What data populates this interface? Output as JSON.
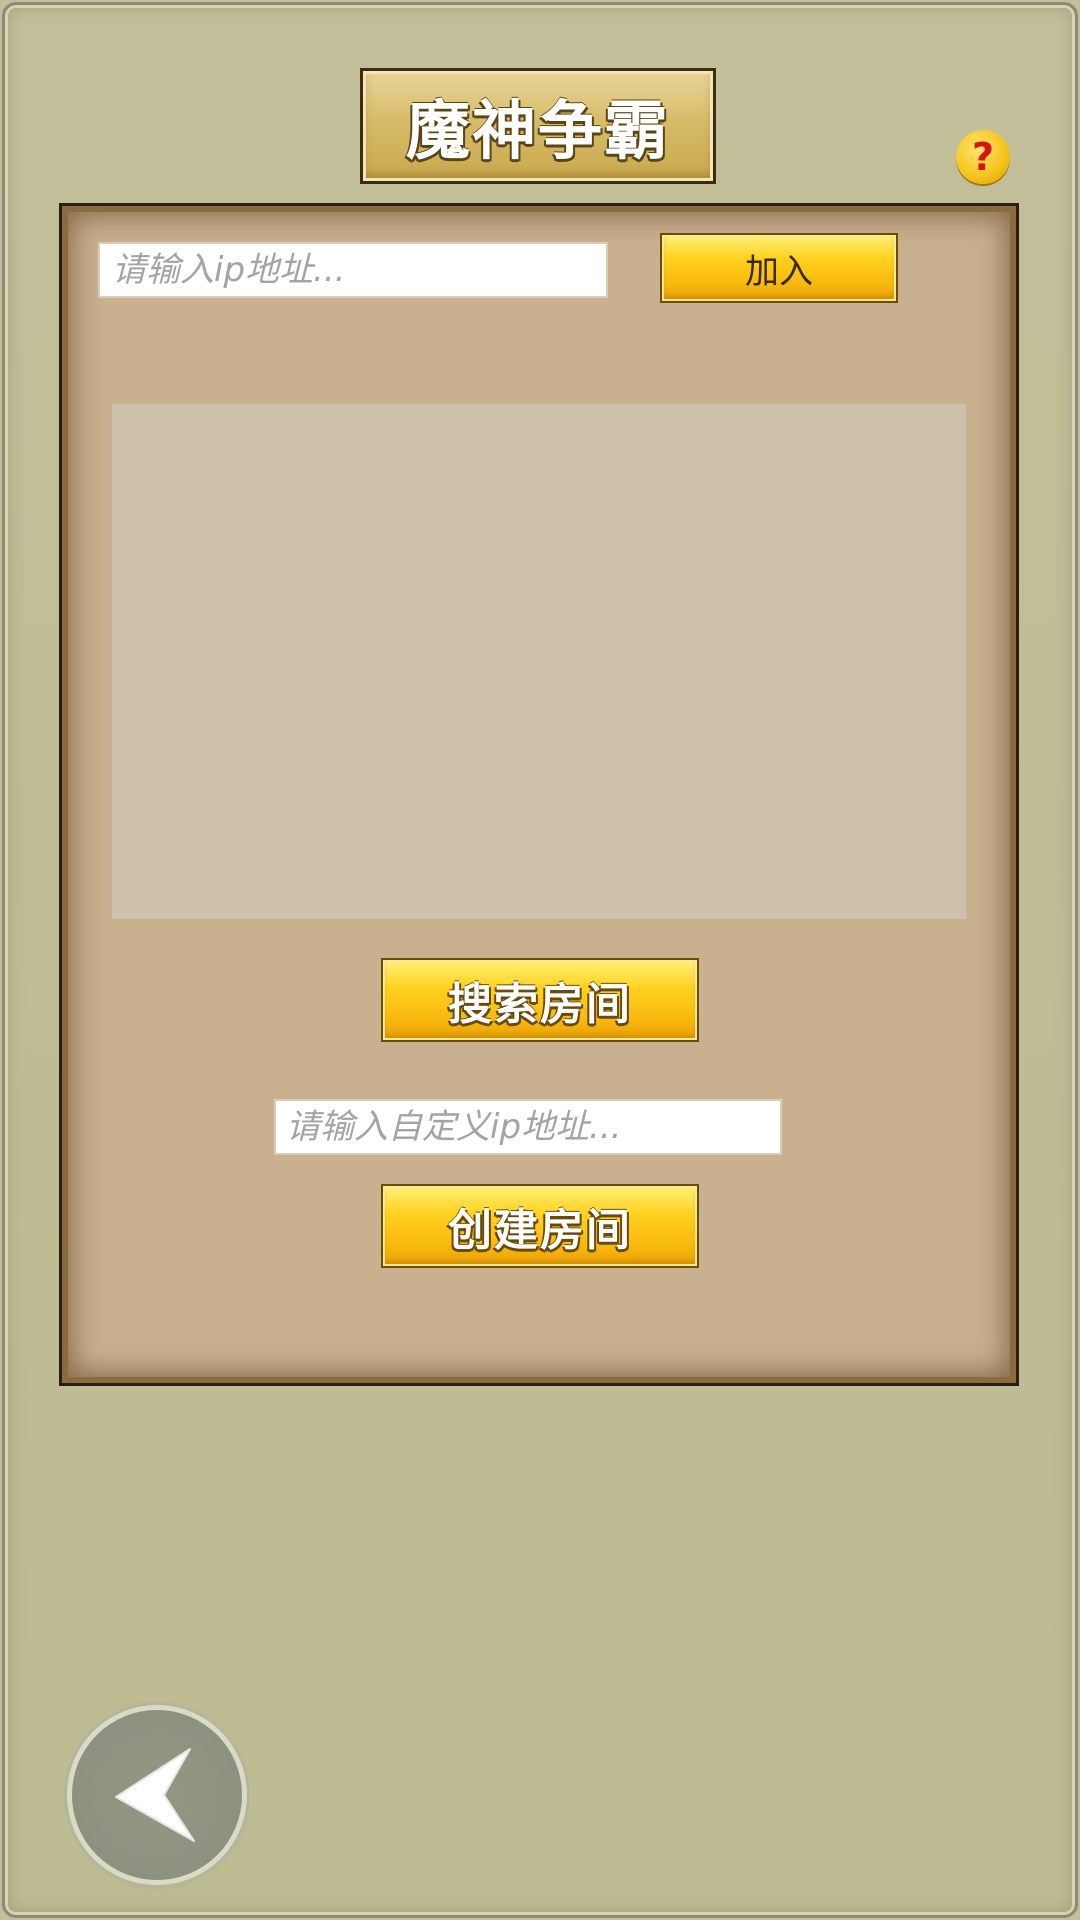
{
  "title": "魔神争霸",
  "help": {
    "glyph": "?"
  },
  "join": {
    "ip_placeholder": "请输入ip地址...",
    "join_label": "加入"
  },
  "room_list": {
    "rooms": []
  },
  "search": {
    "label": "搜索房间"
  },
  "create": {
    "custom_ip_placeholder": "请输入自定义ip地址...",
    "label": "创建房间"
  },
  "back": {
    "icon": "back-arrow-icon"
  },
  "colors": {
    "background": "#c2be98",
    "panel": "#c9b08f",
    "button_gold": "#ffd21f",
    "help_question": "#d8121b"
  }
}
